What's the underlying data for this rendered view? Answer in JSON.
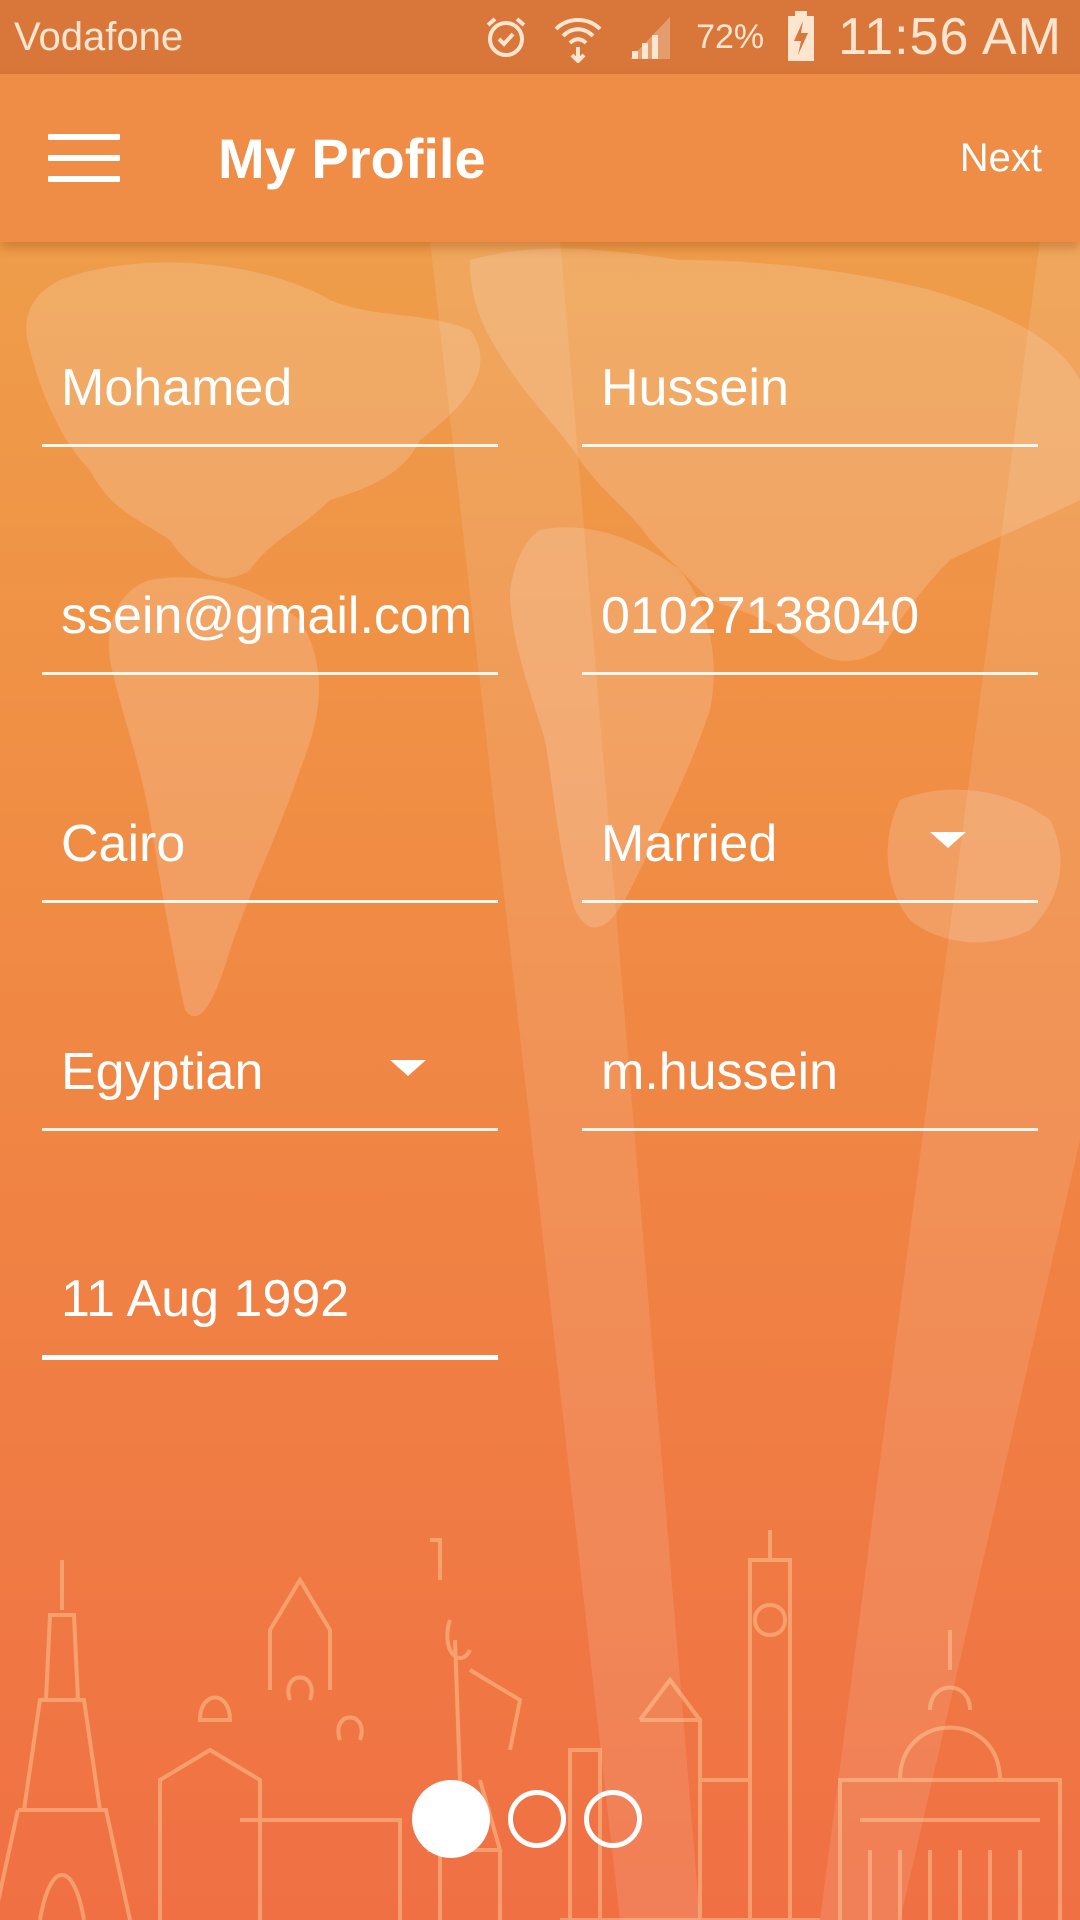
{
  "status_bar": {
    "carrier": "Vodafone",
    "battery": "72%",
    "time": "11:56 AM",
    "icons": [
      "alarm-icon",
      "wifi-icon",
      "signal-icon",
      "battery-charging-icon"
    ]
  },
  "app_bar": {
    "menu_icon": "hamburger-menu-icon",
    "title": "My Profile",
    "next_label": "Next"
  },
  "form": {
    "first_name": "Mohamed",
    "last_name": "Hussein",
    "email": "ssein@gmail.com",
    "phone": "01027138040",
    "city": "Cairo",
    "marital_status": "Married",
    "nationality": "Egyptian",
    "username": "m.hussein",
    "birth_date": "11 Aug 1992"
  },
  "pager": {
    "pages": 3,
    "active_page": 1
  },
  "colors": {
    "status_bar": "#d9773a",
    "app_bar": "#ef8c46",
    "background_top": "#eea44c",
    "background_bottom": "#f07044",
    "text": "#ffffff"
  }
}
